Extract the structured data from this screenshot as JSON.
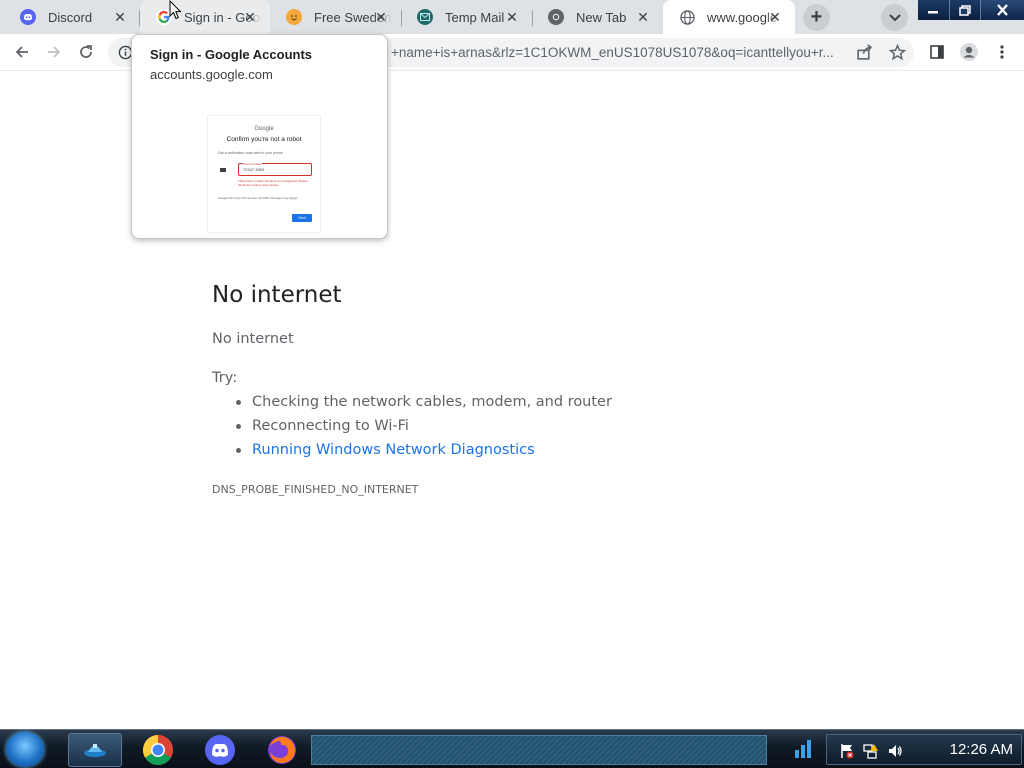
{
  "tabs": [
    {
      "title": "Discord",
      "icon": "discord-icon",
      "state": "normal"
    },
    {
      "title": "Sign in - Google Accounts",
      "icon": "google-icon",
      "state": "hover"
    },
    {
      "title": "Free Swedenl",
      "icon": "emoji-icon",
      "state": "normal"
    },
    {
      "title": "Temp Mail -",
      "icon": "tempmail-icon",
      "state": "normal"
    },
    {
      "title": "New Tab",
      "icon": "chrome-icon",
      "state": "normal"
    },
    {
      "title": "www.google",
      "icon": "globe-icon",
      "state": "active"
    }
  ],
  "toolbar": {
    "url": "+name+is+arnas&rlz=1C1OKWM_enUS1078US1078&oq=icanttellyou+r..."
  },
  "hovercard": {
    "title": "Sign in - Google Accounts",
    "domain": "accounts.google.com",
    "preview": {
      "logo": "Google",
      "heading": "Confirm you're not a robot",
      "intro": "Get a verification code sent to your phone",
      "input_label": "Phone number",
      "input_value": "72347 3853",
      "error_text": "This phone number format is not recognized. Please check the country and number.",
      "help_text": "Google will verify this number via SMS (charges may apply).",
      "next_label": "Next"
    }
  },
  "error_page": {
    "heading": "No internet",
    "subheading": "No internet",
    "try_label": "Try:",
    "suggestions": [
      "Checking the network cables, modem, and router",
      "Reconnecting to Wi-Fi",
      "Running Windows Network Diagnostics"
    ],
    "error_code": "DNS_PROBE_FINISHED_NO_INTERNET"
  },
  "taskbar": {
    "pinned": [
      "app-icon",
      "chrome-icon",
      "discord-icon",
      "firefox-icon"
    ],
    "clock": "12:26 AM"
  },
  "colors": {
    "tabstrip_bg": "#dee1e6",
    "link": "#1a73e8",
    "discord": "#5865f2",
    "tempmail": "#1f6b6b"
  }
}
